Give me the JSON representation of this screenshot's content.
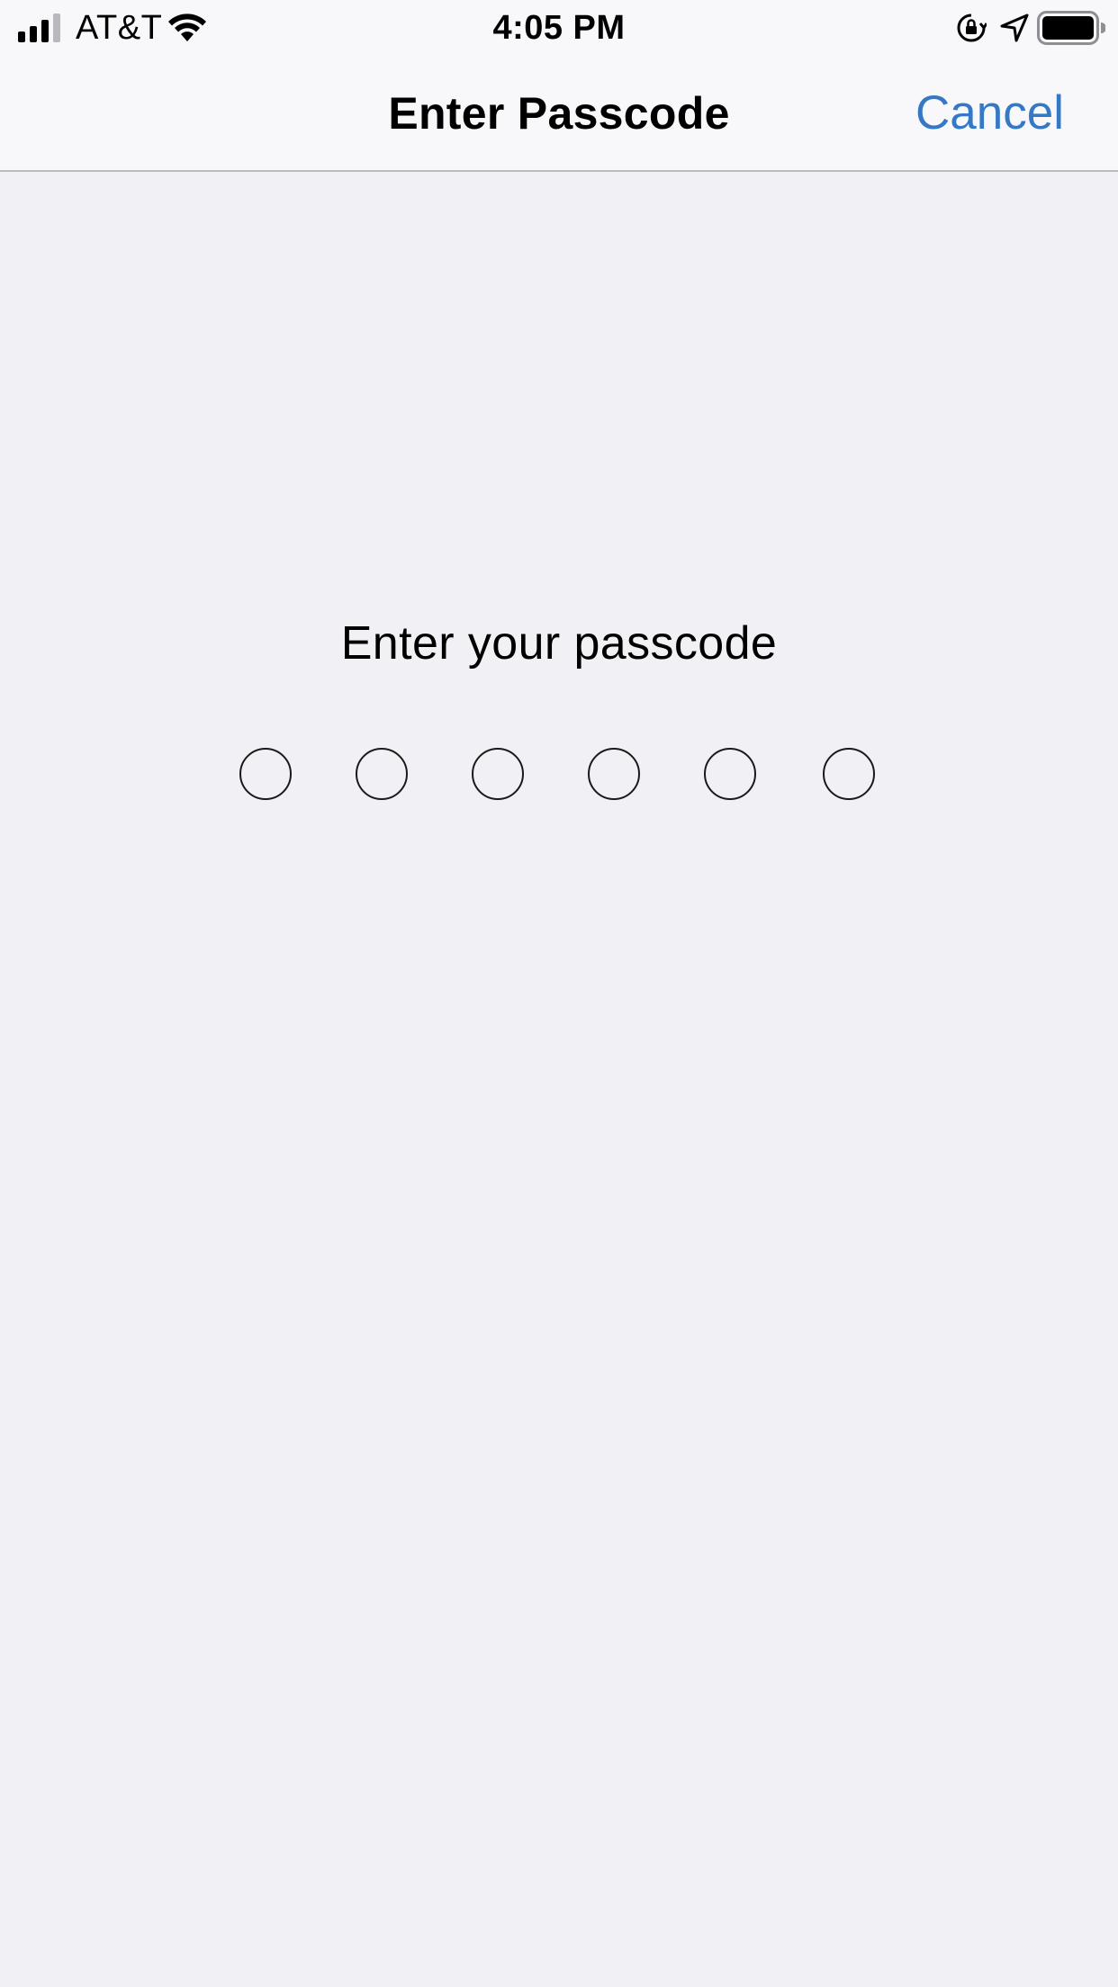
{
  "status_bar": {
    "carrier": "AT&T",
    "time": "4:05 PM",
    "signal_icon": "cellular-signal-icon",
    "wifi_icon": "wifi-icon",
    "rotation_lock_icon": "rotation-lock-icon",
    "location_icon": "location-arrow-icon",
    "battery_icon": "battery-icon"
  },
  "nav": {
    "title": "Enter Passcode",
    "cancel_label": "Cancel"
  },
  "passcode": {
    "prompt": "Enter your passcode",
    "length": 6,
    "filled": 0
  },
  "colors": {
    "accent": "#3478c6",
    "background": "#f0f0f5",
    "bar_background": "#f8f8fa"
  }
}
